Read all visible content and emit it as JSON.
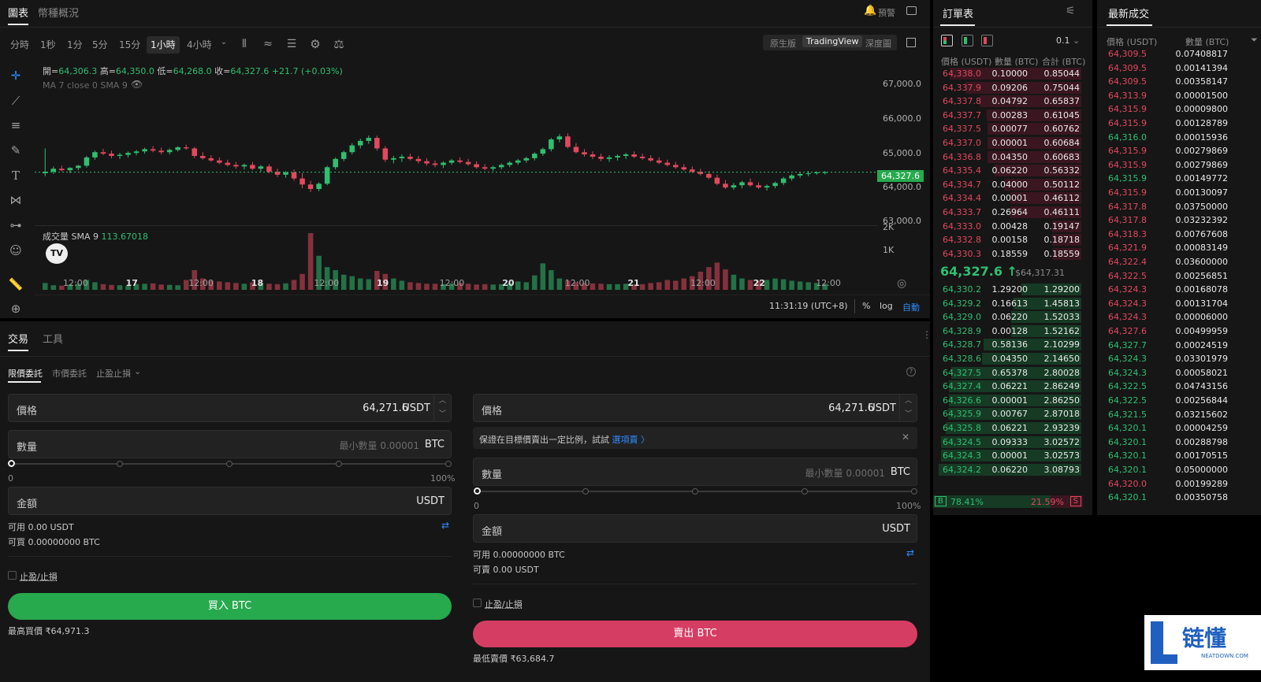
{
  "header": {
    "tabs": [
      "圖表",
      "幣種概況"
    ],
    "alert_label": "預警"
  },
  "timeframes": [
    "分時",
    "1秒",
    "1分",
    "5分",
    "15分",
    "1小時",
    "4小時"
  ],
  "chart_modes": [
    "原生版",
    "TradingView",
    "深度圖"
  ],
  "ohlc": {
    "open_label": "開=",
    "open": "64,306.3",
    "high_label": "高=",
    "high": "64,350.0",
    "low_label": "低=",
    "low": "64,268.0",
    "close_label": "收=",
    "close": "64,327.6",
    "change": "+21.7 (+0.03%)"
  },
  "ma_label": "MA 7 close 0 SMA 9",
  "volume": {
    "label": "成交量 SMA 9",
    "value": "113.67018",
    "ticks": [
      "2K",
      "1K"
    ]
  },
  "price_axis": [
    "67,000.0",
    "66,000.0",
    "65,000.0",
    "64,000.0",
    "63,000.0"
  ],
  "current_price_tag": "64,327.6",
  "time_axis": [
    "12:00",
    "17",
    "12:00",
    "18",
    "12:00",
    "19",
    "12:00",
    "20",
    "12:00",
    "21",
    "12:00",
    "22",
    "12:00"
  ],
  "chart_footer": {
    "time": "11:31:19 (UTC+8)",
    "pct": "%",
    "log": "log",
    "auto": "自動"
  },
  "colors": {
    "up": "#2fbf71",
    "down": "#e2485e",
    "accent": "#2f8cff",
    "buy": "#27a94e",
    "sell": "#d63d62"
  },
  "chart_data": {
    "type": "candlestick",
    "ylim": [
      63000,
      67400
    ],
    "candles": [
      [
        64300,
        64960,
        64220,
        64340
      ],
      [
        64340,
        64480,
        64280,
        64420
      ],
      [
        64420,
        64500,
        64350,
        64380
      ],
      [
        64380,
        64460,
        64300,
        64440
      ],
      [
        64440,
        64520,
        64380,
        64500
      ],
      [
        64500,
        64760,
        64450,
        64720
      ],
      [
        64720,
        64900,
        64660,
        64860
      ],
      [
        64860,
        64950,
        64780,
        64820
      ],
      [
        64820,
        64900,
        64700,
        64760
      ],
      [
        64760,
        64840,
        64680,
        64790
      ],
      [
        64790,
        64880,
        64720,
        64840
      ],
      [
        64840,
        64920,
        64780,
        64880
      ],
      [
        64880,
        64980,
        64820,
        64940
      ],
      [
        64940,
        65020,
        64860,
        64900
      ],
      [
        64900,
        64980,
        64800,
        64860
      ],
      [
        64860,
        64960,
        64800,
        64920
      ],
      [
        64920,
        65020,
        64880,
        64990
      ],
      [
        64990,
        65060,
        64920,
        64960
      ],
      [
        64960,
        65000,
        64700,
        64760
      ],
      [
        64760,
        64860,
        64660,
        64700
      ],
      [
        64700,
        64780,
        64600,
        64640
      ],
      [
        64640,
        64720,
        64540,
        64580
      ],
      [
        64580,
        64660,
        64480,
        64520
      ],
      [
        64520,
        64600,
        64420,
        64480
      ],
      [
        64480,
        64560,
        64400,
        64520
      ],
      [
        64520,
        64600,
        64380,
        64420
      ],
      [
        64420,
        64520,
        64340,
        64480
      ],
      [
        64480,
        64540,
        64300,
        64340
      ],
      [
        64340,
        64420,
        64200,
        64260
      ],
      [
        64260,
        64360,
        64180,
        64320
      ],
      [
        64320,
        64400,
        64100,
        64160
      ],
      [
        64160,
        64300,
        63900,
        64000
      ],
      [
        64000,
        64100,
        63800,
        63880
      ],
      [
        63880,
        64060,
        63820,
        64020
      ],
      [
        64020,
        64500,
        63980,
        64460
      ],
      [
        64460,
        64720,
        64400,
        64680
      ],
      [
        64680,
        64900,
        64620,
        64860
      ],
      [
        64860,
        65100,
        64800,
        65040
      ],
      [
        65040,
        65220,
        64960,
        65160
      ],
      [
        65160,
        65300,
        65080,
        65240
      ],
      [
        65240,
        65300,
        64900,
        64960
      ],
      [
        64960,
        65020,
        64600,
        64660
      ],
      [
        64660,
        64760,
        64560,
        64700
      ],
      [
        64700,
        64800,
        64600,
        64740
      ],
      [
        64740,
        64820,
        64640,
        64680
      ],
      [
        64680,
        64760,
        64560,
        64620
      ],
      [
        64620,
        64700,
        64500,
        64560
      ],
      [
        64560,
        64640,
        64460,
        64520
      ],
      [
        64520,
        64620,
        64440,
        64580
      ],
      [
        64580,
        64680,
        64520,
        64640
      ],
      [
        64640,
        64720,
        64560,
        64600
      ],
      [
        64600,
        64680,
        64500,
        64540
      ],
      [
        64540,
        64620,
        64420,
        64460
      ],
      [
        64460,
        64540,
        64380,
        64420
      ],
      [
        64420,
        64500,
        64360,
        64460
      ],
      [
        64460,
        64560,
        64400,
        64520
      ],
      [
        64520,
        64620,
        64460,
        64580
      ],
      [
        64580,
        64680,
        64520,
        64640
      ],
      [
        64640,
        64740,
        64580,
        64700
      ],
      [
        64700,
        64860,
        64640,
        64820
      ],
      [
        64820,
        64980,
        64760,
        64940
      ],
      [
        64940,
        65240,
        64880,
        65200
      ],
      [
        65200,
        65340,
        65120,
        65280
      ],
      [
        65280,
        65360,
        64960,
        65000
      ],
      [
        65000,
        65100,
        64820,
        64860
      ],
      [
        64860,
        64940,
        64740,
        64800
      ],
      [
        64800,
        64880,
        64680,
        64740
      ],
      [
        64740,
        64820,
        64620,
        64680
      ],
      [
        64680,
        64780,
        64600,
        64720
      ],
      [
        64720,
        64800,
        64640,
        64760
      ],
      [
        64760,
        64840,
        64680,
        64800
      ],
      [
        64800,
        64880,
        64700,
        64740
      ],
      [
        64740,
        64820,
        64660,
        64700
      ],
      [
        64700,
        64780,
        64600,
        64640
      ],
      [
        64640,
        64720,
        64540,
        64580
      ],
      [
        64580,
        64660,
        64480,
        64520
      ],
      [
        64520,
        64600,
        64420,
        64460
      ],
      [
        64460,
        64540,
        64360,
        64400
      ],
      [
        64400,
        64480,
        64300,
        64340
      ],
      [
        64340,
        64420,
        64240,
        64280
      ],
      [
        64280,
        64360,
        64140,
        64180
      ],
      [
        64180,
        64260,
        63980,
        64020
      ],
      [
        64020,
        64120,
        63880,
        63920
      ],
      [
        63920,
        64040,
        63860,
        63980
      ],
      [
        63980,
        64100,
        63900,
        64060
      ],
      [
        64060,
        64160,
        63940,
        63980
      ],
      [
        63980,
        64060,
        63880,
        63920
      ],
      [
        63920,
        64000,
        63840,
        63960
      ],
      [
        63960,
        64080,
        63900,
        64040
      ],
      [
        64040,
        64200,
        63980,
        64160
      ],
      [
        64160,
        64280,
        64100,
        64240
      ],
      [
        64240,
        64320,
        64180,
        64280
      ],
      [
        64280,
        64360,
        64220,
        64300
      ],
      [
        64300,
        64350,
        64260,
        64320
      ],
      [
        64320,
        64360,
        64268,
        64327.6
      ]
    ],
    "volumes": [
      180,
      120,
      110,
      140,
      160,
      260,
      200,
      150,
      130,
      120,
      110,
      150,
      160,
      170,
      140,
      130,
      120,
      260,
      520,
      300,
      240,
      220,
      200,
      180,
      160,
      200,
      180,
      160,
      150,
      170,
      260,
      420,
      1500,
      900,
      600,
      520,
      400,
      360,
      300,
      280,
      500,
      420,
      300,
      240,
      200,
      180,
      160,
      160,
      150,
      170,
      180,
      160,
      140,
      150,
      140,
      150,
      170,
      220,
      200,
      380,
      700,
      520,
      300,
      240,
      200,
      180,
      170,
      160,
      150,
      150,
      160,
      140,
      150,
      180,
      200,
      260,
      240,
      300,
      360,
      480,
      600,
      720,
      540,
      400,
      300,
      260,
      240,
      260,
      300,
      280,
      240,
      220,
      200,
      180,
      160
    ]
  },
  "orderbook": {
    "title": "訂單表",
    "precision": "0.1",
    "headers": [
      "價格 (USDT)",
      "數量 (BTC)",
      "合計 (BTC)"
    ],
    "asks": [
      [
        "64,338.0",
        "0.10000",
        "0.85044",
        0.85044
      ],
      [
        "64,337.9",
        "0.09206",
        "0.75044",
        0.75044
      ],
      [
        "64,337.8",
        "0.04792",
        "0.65837",
        0.65837
      ],
      [
        "64,337.7",
        "0.00283",
        "0.61045",
        0.61045
      ],
      [
        "64,337.5",
        "0.00077",
        "0.60762",
        0.60762
      ],
      [
        "64,337.0",
        "0.00001",
        "0.60684",
        0.60684
      ],
      [
        "64,336.8",
        "0.04350",
        "0.60683",
        0.60683
      ],
      [
        "64,335.4",
        "0.06220",
        "0.56332",
        0.56332
      ],
      [
        "64,334.7",
        "0.04000",
        "0.50112",
        0.50112
      ],
      [
        "64,334.4",
        "0.00001",
        "0.46112",
        0.46112
      ],
      [
        "64,333.7",
        "0.26964",
        "0.46111",
        0.46111
      ],
      [
        "64,333.0",
        "0.00428",
        "0.19147",
        0.19147
      ],
      [
        "64,332.8",
        "0.00158",
        "0.18718",
        0.18718
      ],
      [
        "64,330.3",
        "0.18559",
        "0.18559",
        0.18559
      ]
    ],
    "last_price": "64,327.6 ↑",
    "mark_price": "$64,317.31",
    "bids": [
      [
        "64,330.2",
        "1.29200",
        "1.29200",
        1.292
      ],
      [
        "64,329.2",
        "0.16613",
        "1.45813",
        1.45813
      ],
      [
        "64,329.0",
        "0.06220",
        "1.52033",
        1.52033
      ],
      [
        "64,328.9",
        "0.00128",
        "1.52162",
        1.52162
      ],
      [
        "64,328.7",
        "0.58136",
        "2.10299",
        2.10299
      ],
      [
        "64,328.6",
        "0.04350",
        "2.14650",
        2.1465
      ],
      [
        "64,327.5",
        "0.65378",
        "2.80028",
        2.80028
      ],
      [
        "64,327.4",
        "0.06221",
        "2.86249",
        2.86249
      ],
      [
        "64,326.6",
        "0.00001",
        "2.86250",
        2.8625
      ],
      [
        "64,325.9",
        "0.00767",
        "2.87018",
        2.87018
      ],
      [
        "64,325.8",
        "0.06221",
        "2.93239",
        2.93239
      ],
      [
        "64,324.5",
        "0.09333",
        "3.02572",
        3.02572
      ],
      [
        "64,324.3",
        "0.00001",
        "3.02573",
        3.02573
      ],
      [
        "64,324.2",
        "0.06220",
        "3.08793",
        3.08793
      ]
    ],
    "buy_label": "B",
    "buy_pct": "78.41%",
    "sell_pct": "21.59%",
    "sell_label": "S"
  },
  "trades": {
    "title": "最新成交",
    "headers": [
      "價格 (USDT)",
      "數量 (BTC)"
    ],
    "rows": [
      [
        "64,309.5",
        "0.07408817",
        "red"
      ],
      [
        "64,309.5",
        "0.00141394",
        "red"
      ],
      [
        "64,309.5",
        "0.00358147",
        "red"
      ],
      [
        "64,313.9",
        "0.00001500",
        "red"
      ],
      [
        "64,315.9",
        "0.00009800",
        "red"
      ],
      [
        "64,315.9",
        "0.00128789",
        "red"
      ],
      [
        "64,316.0",
        "0.00015936",
        "green"
      ],
      [
        "64,315.9",
        "0.00279869",
        "red"
      ],
      [
        "64,315.9",
        "0.00279869",
        "red"
      ],
      [
        "64,315.9",
        "0.00149772",
        "green"
      ],
      [
        "64,315.9",
        "0.00130097",
        "red"
      ],
      [
        "64,317.8",
        "0.03750000",
        "red"
      ],
      [
        "64,317.8",
        "0.03232392",
        "red"
      ],
      [
        "64,318.3",
        "0.00767608",
        "red"
      ],
      [
        "64,321.9",
        "0.00083149",
        "red"
      ],
      [
        "64,322.4",
        "0.03600000",
        "red"
      ],
      [
        "64,322.5",
        "0.00256851",
        "red"
      ],
      [
        "64,324.3",
        "0.00168078",
        "red"
      ],
      [
        "64,324.3",
        "0.00131704",
        "red"
      ],
      [
        "64,324.3",
        "0.00006000",
        "red"
      ],
      [
        "64,327.6",
        "0.00499959",
        "red"
      ],
      [
        "64,327.7",
        "0.00024519",
        "green"
      ],
      [
        "64,324.3",
        "0.03301979",
        "green"
      ],
      [
        "64,324.3",
        "0.00058021",
        "green"
      ],
      [
        "64,322.5",
        "0.04743156",
        "green"
      ],
      [
        "64,322.5",
        "0.00256844",
        "green"
      ],
      [
        "64,321.5",
        "0.03215602",
        "green"
      ],
      [
        "64,320.1",
        "0.00004259",
        "green"
      ],
      [
        "64,320.1",
        "0.00288798",
        "green"
      ],
      [
        "64,320.1",
        "0.00170515",
        "green"
      ],
      [
        "64,320.1",
        "0.05000000",
        "green"
      ],
      [
        "64,320.0",
        "0.00199289",
        "red"
      ],
      [
        "64,320.1",
        "0.00350758",
        "green"
      ]
    ]
  },
  "trade": {
    "tabs": [
      "交易",
      "工具"
    ],
    "order_types": [
      "限價委託",
      "市價委託",
      "止盈止損"
    ],
    "buy": {
      "price_label": "價格",
      "price_value": "64,271.6",
      "price_unit": "USDT",
      "qty_label": "數量",
      "qty_placeholder": "最小數量 0.00001",
      "qty_unit": "BTC",
      "slider_min": "0",
      "slider_max": "100%",
      "amount_label": "金額",
      "amount_unit": "USDT",
      "avail": "可用 0.00 USDT",
      "can_buy": "可買 0.00000000 BTC",
      "tpsl": "止盈/止損",
      "button": "買入 BTC",
      "limit": "最高買價 ₹64,971.3"
    },
    "sell": {
      "price_label": "價格",
      "price_value": "64,271.6",
      "price_unit": "USDT",
      "hint": "保證在目標價賣出一定比例，試試",
      "hint_link": "選項賣 〉",
      "qty_label": "數量",
      "qty_placeholder": "最小數量 0.00001",
      "qty_unit": "BTC",
      "slider_min": "0",
      "slider_max": "100%",
      "amount_label": "金額",
      "amount_unit": "USDT",
      "avail": "可用 0.00000000 BTC",
      "can_sell": "可賣 0.00 USDT",
      "tpsl": "止盈/止損",
      "button": "賣出 BTC",
      "limit": "最低賣價 ₹63,684.7"
    }
  },
  "watermark": {
    "text": "链懂",
    "sub": "NEATDOWN.COM"
  }
}
